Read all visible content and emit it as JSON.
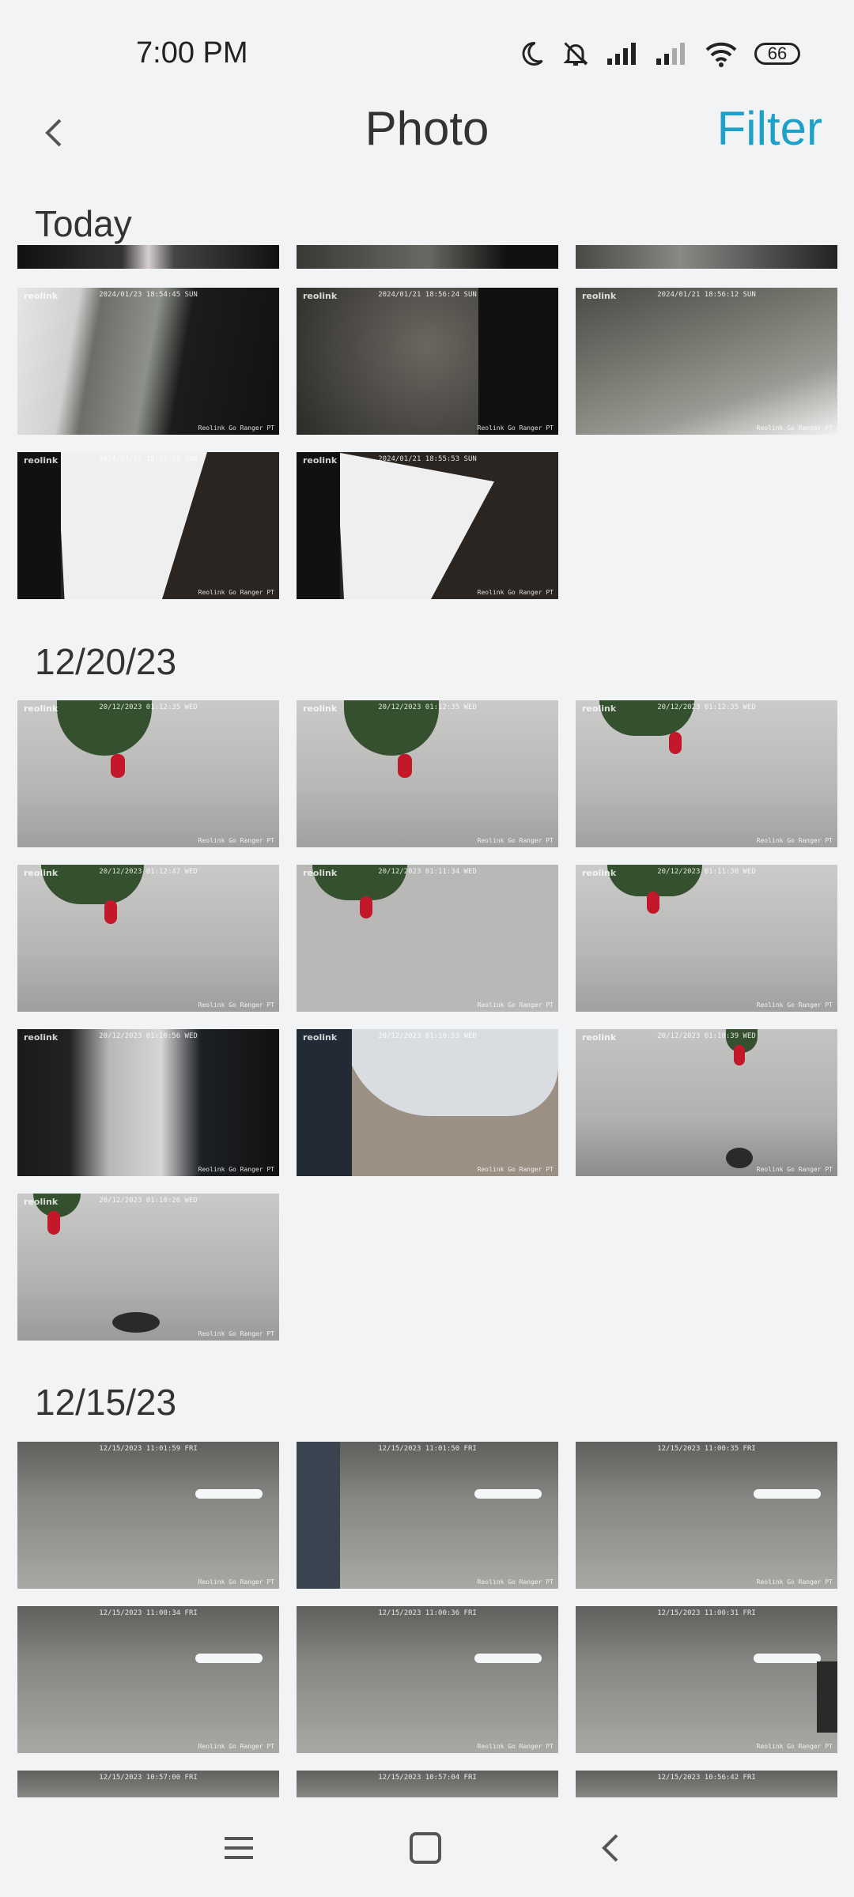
{
  "status": {
    "time": "7:00 PM",
    "battery": "66"
  },
  "header": {
    "title": "Photo",
    "filter_label": "Filter"
  },
  "sections": [
    {
      "label": "Today"
    },
    {
      "label": "12/20/23"
    },
    {
      "label": "12/15/23"
    }
  ],
  "thumbs": {
    "today": [
      {
        "ts": "2024/01/23 18:54:45 SUN",
        "mark": "Reolink Go Ranger PT"
      },
      {
        "ts": "2024/01/21 18:56:24 SUN",
        "mark": "Reolink Go Ranger PT"
      },
      {
        "ts": "2024/01/21 18:56:12 SUN",
        "mark": "Reolink Go Ranger PT"
      },
      {
        "ts": "2024/01/21 18:55:58 SUN",
        "mark": "Reolink Go Ranger PT"
      },
      {
        "ts": "2024/01/21 18:55:53 SUN",
        "mark": "Reolink Go Ranger PT"
      }
    ],
    "dec20": [
      {
        "ts": "20/12/2023 01:12:35 WED",
        "mark": "Reolink Go Ranger PT"
      },
      {
        "ts": "20/12/2023 01:12:35 WED",
        "mark": "Reolink Go Ranger PT"
      },
      {
        "ts": "20/12/2023 01:12:35 WED",
        "mark": "Reolink Go Ranger PT"
      },
      {
        "ts": "20/12/2023 01:12:47 WED",
        "mark": "Reolink Go Ranger PT"
      },
      {
        "ts": "20/12/2023 01:11:34 WED",
        "mark": "Reolink Go Ranger PT"
      },
      {
        "ts": "20/12/2023 01:11:30 WED",
        "mark": "Reolink Go Ranger PT"
      },
      {
        "ts": "20/12/2023 01:10:56 WED",
        "mark": "Reolink Go Ranger PT"
      },
      {
        "ts": "20/12/2023 01:10:53 WED",
        "mark": "Reolink Go Ranger PT"
      },
      {
        "ts": "20/12/2023 01:10:39 WED",
        "mark": "Reolink Go Ranger PT"
      },
      {
        "ts": "20/12/2023 01:10:26 WED",
        "mark": "Reolink Go Ranger PT"
      }
    ],
    "dec15": [
      {
        "ts": "12/15/2023 11:01:59 FRI",
        "mark": "Reolink Go Ranger PT"
      },
      {
        "ts": "12/15/2023 11:01:50 FRI",
        "mark": "Reolink Go Ranger PT"
      },
      {
        "ts": "12/15/2023 11:00:35 FRI",
        "mark": "Reolink Go Ranger PT"
      },
      {
        "ts": "12/15/2023 11:00:34 FRI",
        "mark": "Reolink Go Ranger PT"
      },
      {
        "ts": "12/15/2023 11:00:36 FRI",
        "mark": "Reolink Go Ranger PT"
      },
      {
        "ts": "12/15/2023 11:00:31 FRI",
        "mark": "Reolink Go Ranger PT"
      },
      {
        "ts": "12/15/2023 10:57:00 FRI",
        "mark": "Reolink Go Ranger PT"
      },
      {
        "ts": "12/15/2023 10:57:04 FRI",
        "mark": "Reolink Go Ranger PT"
      },
      {
        "ts": "12/15/2023 10:56:42 FRI",
        "mark": "Reolink Go Ranger PT"
      }
    ],
    "logo": "reolink"
  },
  "icons": {
    "moon": "moon-icon",
    "mute": "bell-off-icon",
    "signal": "signal-icon",
    "wifi": "wifi-icon",
    "back": "chevron-left-icon",
    "menu": "menu-icon",
    "home": "home-square-icon",
    "nav_back": "nav-back-icon"
  },
  "colors": {
    "accent": "#1da1c9",
    "background": "#f2f3f5"
  }
}
